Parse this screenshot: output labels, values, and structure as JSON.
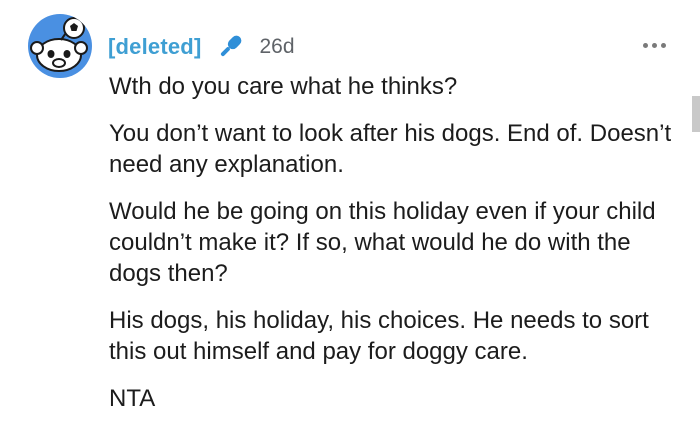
{
  "comment": {
    "avatar_icon": "snoo-avatar-icon",
    "username": "[deleted]",
    "mic_icon": "microphone-icon",
    "timestamp": "26d",
    "more_icon": "more-options-icon",
    "paragraphs": [
      "Wth do you care what he thinks?",
      "You don’t want to look after his dogs. End of. Doesn’t need any explanation.",
      "Would he be going on this holiday even if your child couldn’t make it? If so, what would he do with the dogs then?",
      "His dogs, his holiday, his choices. He needs to sort this out himself and pay for doggy care.",
      "NTA"
    ]
  },
  "colors": {
    "username": "#3f9fd3",
    "mic": "#2f8fd8",
    "text": "#1c1c1c",
    "timestamp": "#5f6368",
    "avatar_bg": "#4a90e2"
  }
}
